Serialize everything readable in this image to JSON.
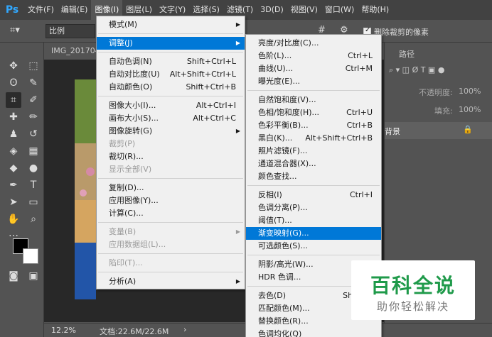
{
  "app": {
    "logo": "Ps"
  },
  "menubar": {
    "items": [
      "文件(F)",
      "编辑(E)",
      "图像(I)",
      "图层(L)",
      "文字(Y)",
      "选择(S)",
      "滤镜(T)",
      "3D(D)",
      "视图(V)",
      "窗口(W)",
      "帮助(H)"
    ],
    "active_index": 2
  },
  "options_bar": {
    "ratio_select": "比例",
    "delete_cropped_label": "删除裁剪的像素",
    "delete_cropped_checked": true
  },
  "document": {
    "tab_title": "IMG_201704",
    "zoom": "12.2%",
    "doc_info": "文档:22.6M/22.6M"
  },
  "panel": {
    "tab_paths": "路径",
    "opacity_label": "不透明度:",
    "opacity_value": "100%",
    "fill_label": "填充:",
    "fill_value": "100%",
    "layer_name": "背景"
  },
  "image_menu": {
    "items": [
      {
        "label": "模式(M)",
        "shortcut": "",
        "submenu": true,
        "disabled": false
      },
      {
        "label": "调整(J)",
        "shortcut": "",
        "submenu": true,
        "disabled": false,
        "highlighted": true
      },
      {
        "label": "自动色调(N)",
        "shortcut": "Shift+Ctrl+L",
        "submenu": false,
        "disabled": false
      },
      {
        "label": "自动对比度(U)",
        "shortcut": "Alt+Shift+Ctrl+L",
        "submenu": false,
        "disabled": false
      },
      {
        "label": "自动颜色(O)",
        "shortcut": "Shift+Ctrl+B",
        "submenu": false,
        "disabled": false
      },
      {
        "label": "图像大小(I)...",
        "shortcut": "Alt+Ctrl+I",
        "submenu": false,
        "disabled": false
      },
      {
        "label": "画布大小(S)...",
        "shortcut": "Alt+Ctrl+C",
        "submenu": false,
        "disabled": false
      },
      {
        "label": "图像旋转(G)",
        "shortcut": "",
        "submenu": true,
        "disabled": false
      },
      {
        "label": "裁剪(P)",
        "shortcut": "",
        "submenu": false,
        "disabled": true
      },
      {
        "label": "裁切(R)...",
        "shortcut": "",
        "submenu": false,
        "disabled": false
      },
      {
        "label": "显示全部(V)",
        "shortcut": "",
        "submenu": false,
        "disabled": true
      },
      {
        "label": "复制(D)...",
        "shortcut": "",
        "submenu": false,
        "disabled": false
      },
      {
        "label": "应用图像(Y)...",
        "shortcut": "",
        "submenu": false,
        "disabled": false
      },
      {
        "label": "计算(C)...",
        "shortcut": "",
        "submenu": false,
        "disabled": false
      },
      {
        "label": "变量(B)",
        "shortcut": "",
        "submenu": true,
        "disabled": true
      },
      {
        "label": "应用数据组(L)...",
        "shortcut": "",
        "submenu": false,
        "disabled": true
      },
      {
        "label": "陷印(T)...",
        "shortcut": "",
        "submenu": false,
        "disabled": true
      },
      {
        "label": "分析(A)",
        "shortcut": "",
        "submenu": true,
        "disabled": false
      }
    ]
  },
  "adjust_menu": {
    "items": [
      {
        "label": "亮度/对比度(C)...",
        "shortcut": ""
      },
      {
        "label": "色阶(L)...",
        "shortcut": "Ctrl+L"
      },
      {
        "label": "曲线(U)...",
        "shortcut": "Ctrl+M"
      },
      {
        "label": "曝光度(E)...",
        "shortcut": ""
      },
      {
        "label": "自然饱和度(V)...",
        "shortcut": ""
      },
      {
        "label": "色相/饱和度(H)...",
        "shortcut": "Ctrl+U"
      },
      {
        "label": "色彩平衡(B)...",
        "shortcut": "Ctrl+B"
      },
      {
        "label": "黑白(K)...",
        "shortcut": "Alt+Shift+Ctrl+B"
      },
      {
        "label": "照片滤镜(F)...",
        "shortcut": ""
      },
      {
        "label": "通道混合器(X)...",
        "shortcut": ""
      },
      {
        "label": "颜色查找...",
        "shortcut": ""
      },
      {
        "label": "反相(I)",
        "shortcut": "Ctrl+I"
      },
      {
        "label": "色调分离(P)...",
        "shortcut": ""
      },
      {
        "label": "阈值(T)...",
        "shortcut": ""
      },
      {
        "label": "渐变映射(G)...",
        "shortcut": "",
        "highlighted": true
      },
      {
        "label": "可选颜色(S)...",
        "shortcut": ""
      },
      {
        "label": "阴影/高光(W)...",
        "shortcut": ""
      },
      {
        "label": "HDR 色调...",
        "shortcut": ""
      },
      {
        "label": "去色(D)",
        "shortcut": "Shift+C"
      },
      {
        "label": "匹配颜色(M)...",
        "shortcut": ""
      },
      {
        "label": "替换颜色(R)...",
        "shortcut": ""
      },
      {
        "label": "色调均化(Q)",
        "shortcut": ""
      }
    ]
  },
  "watermark": {
    "title": "百科全说",
    "subtitle": "助你轻松解决"
  },
  "colors": {
    "menu_highlight": "#0078d7",
    "ps_blue": "#31a8ff",
    "watermark_green": "#1f9a4a"
  }
}
